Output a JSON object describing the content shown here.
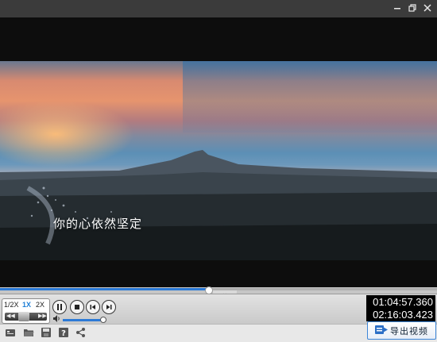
{
  "window": {
    "minimize_icon": "minimize-icon",
    "restore_icon": "restore-icon",
    "close_icon": "close-icon"
  },
  "video": {
    "subtitle": "你的心依然坚定"
  },
  "playback": {
    "progress": 0.478
  },
  "speed": {
    "options": [
      "1/2X",
      "1X",
      "2X"
    ],
    "selected": "1X"
  },
  "controls": {
    "pause_icon": "pause-icon",
    "stop_icon": "stop-icon",
    "prev_icon": "previous-frame-icon",
    "next_icon": "next-frame-icon"
  },
  "volume": {
    "level": 0.96,
    "icon": "volume-icon"
  },
  "time": {
    "current": "01:04:57.360",
    "total": "02:16:03.423"
  },
  "toolbar": {
    "icons": [
      "screenshot-icon",
      "open-folder-icon",
      "save-icon",
      "help-icon",
      "share-icon"
    ],
    "export_label": "导出视频"
  },
  "colors": {
    "accent": "#2c7ad6"
  }
}
